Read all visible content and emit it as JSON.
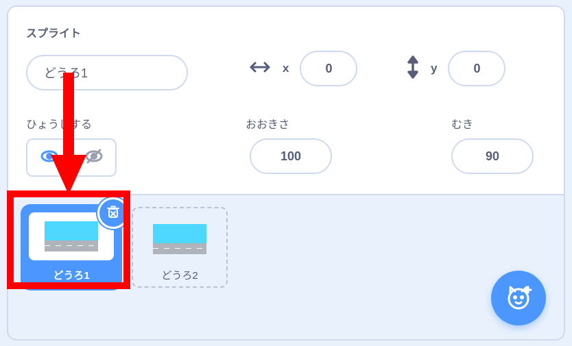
{
  "labels": {
    "sprite": "スプライト",
    "show": "ひょうじする",
    "size": "おおきさ",
    "direction": "むき",
    "x": "x",
    "y": "y"
  },
  "sprite": {
    "name": "どうろ1",
    "x": "0",
    "y": "0",
    "size": "100",
    "direction": "90",
    "visible": true
  },
  "sprites": [
    {
      "name": "どうろ1",
      "selected": true
    },
    {
      "name": "どうろ2",
      "selected": false
    }
  ],
  "icons": {
    "harrow": "harrow-icon",
    "varrow": "varrow-icon",
    "eyeOpen": "eye-open-icon",
    "eyeOff": "eye-off-icon",
    "trash": "trash-icon",
    "catPlus": "cat-plus-icon"
  },
  "colors": {
    "accent": "#4c97ff",
    "annotation": "#ff0000"
  }
}
